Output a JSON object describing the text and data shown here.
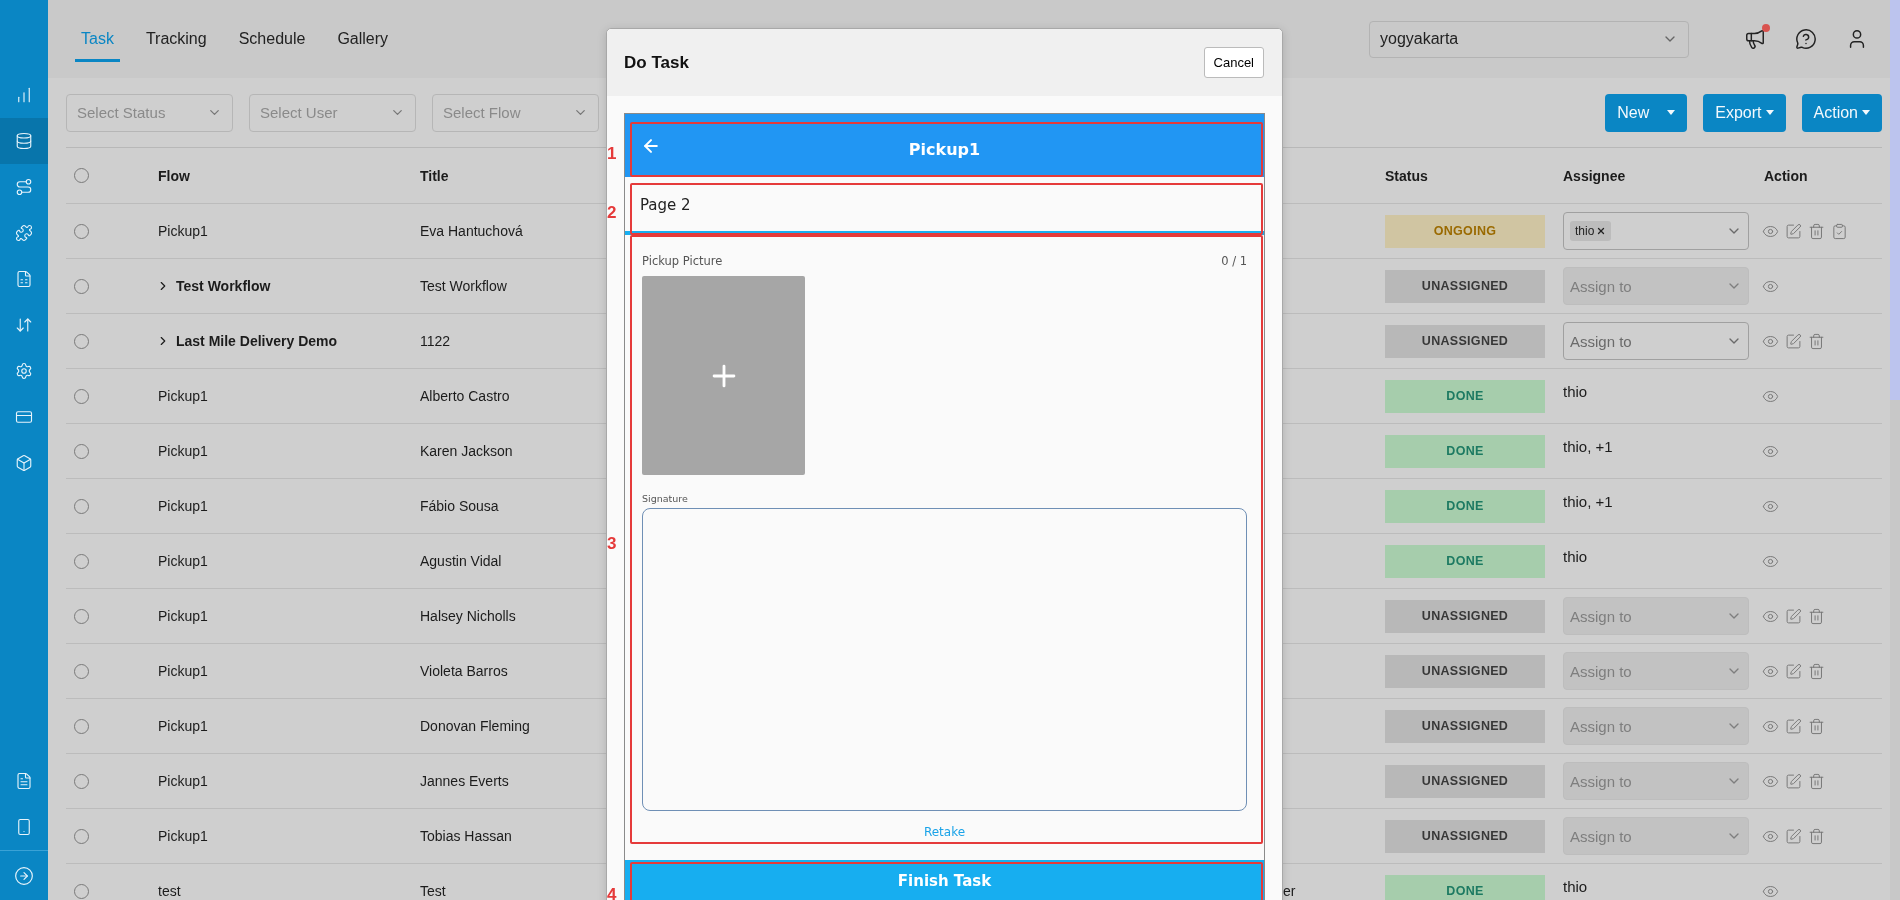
{
  "sidebar": {
    "items": [
      {
        "kind": "chart",
        "selected": false
      },
      {
        "kind": "database",
        "selected": true
      },
      {
        "kind": "route",
        "selected": false
      },
      {
        "kind": "puzzle",
        "selected": false
      },
      {
        "kind": "sheet",
        "selected": false
      },
      {
        "kind": "swap",
        "selected": false
      },
      {
        "kind": "settings",
        "selected": false
      },
      {
        "kind": "card",
        "selected": false
      },
      {
        "kind": "box",
        "selected": false
      }
    ],
    "bottom_items": [
      {
        "kind": "document",
        "selected": false
      },
      {
        "kind": "phone",
        "selected": false
      }
    ]
  },
  "tabs": [
    {
      "label": "Task",
      "selected": true
    },
    {
      "label": "Tracking",
      "selected": false
    },
    {
      "label": "Schedule",
      "selected": false
    },
    {
      "label": "Gallery",
      "selected": false
    }
  ],
  "region_select": {
    "value": "yogyakarta"
  },
  "header_icons": [
    {
      "kind": "announcement",
      "badge": true
    },
    {
      "kind": "help",
      "badge": false
    },
    {
      "kind": "account",
      "badge": false
    }
  ],
  "filters": [
    {
      "placeholder": "Select Status"
    },
    {
      "placeholder": "Select User"
    },
    {
      "placeholder": "Select Flow"
    }
  ],
  "buttons": [
    {
      "label": "New",
      "split": true
    },
    {
      "label": "Export",
      "split": false
    },
    {
      "label": "Action",
      "split": false
    }
  ],
  "table": {
    "columns": [
      "Flow",
      "Title",
      "Status",
      "Assignee",
      "Action"
    ],
    "header_checked": false,
    "rows": [
      {
        "checked": false,
        "kind": "task",
        "flow": "Pickup1",
        "title": "Eva Hantuchová",
        "status": {
          "label": "ONGOING",
          "kind": "ongoing"
        },
        "assignee": {
          "kind": "tag",
          "value": "thio"
        },
        "actions": [
          {
            "kind": "view"
          },
          {
            "kind": "edit"
          },
          {
            "kind": "delete"
          },
          {
            "kind": "review"
          }
        ]
      },
      {
        "checked": false,
        "kind": "group",
        "expanded": false,
        "flow": "Test Workflow",
        "title": "Test Workflow",
        "status": {
          "label": "UNASSIGNED",
          "kind": "unassigned"
        },
        "assignee": {
          "kind": "select",
          "placeholder": "Assign to",
          "disabled": true
        },
        "actions": [
          {
            "kind": "view"
          }
        ]
      },
      {
        "checked": false,
        "kind": "group",
        "expanded": false,
        "flow": "Last Mile Delivery Demo",
        "title": "1122",
        "status": {
          "label": "UNASSIGNED",
          "kind": "unassigned"
        },
        "assignee": {
          "kind": "select",
          "placeholder": "Assign to",
          "disabled": false
        },
        "actions": [
          {
            "kind": "view"
          },
          {
            "kind": "edit"
          },
          {
            "kind": "delete"
          }
        ]
      },
      {
        "checked": false,
        "kind": "task",
        "flow": "Pickup1",
        "title": "Alberto Castro",
        "status": {
          "label": "DONE",
          "kind": "done"
        },
        "assignee": {
          "kind": "text",
          "value": "thio"
        },
        "actions": [
          {
            "kind": "view"
          }
        ]
      },
      {
        "checked": false,
        "kind": "task",
        "flow": "Pickup1",
        "title": "Karen Jackson",
        "status": {
          "label": "DONE",
          "kind": "done"
        },
        "assignee": {
          "kind": "text",
          "value": "thio, +1"
        },
        "actions": [
          {
            "kind": "view"
          }
        ]
      },
      {
        "checked": false,
        "kind": "task",
        "flow": "Pickup1",
        "title": "Fábio Sousa",
        "status": {
          "label": "DONE",
          "kind": "done"
        },
        "assignee": {
          "kind": "text",
          "value": "thio, +1"
        },
        "actions": [
          {
            "kind": "view"
          }
        ]
      },
      {
        "checked": false,
        "kind": "task",
        "flow": "Pickup1",
        "title": "Agustin Vidal",
        "status": {
          "label": "DONE",
          "kind": "done"
        },
        "assignee": {
          "kind": "text",
          "value": "thio"
        },
        "actions": [
          {
            "kind": "view"
          }
        ]
      },
      {
        "checked": false,
        "kind": "task",
        "flow": "Pickup1",
        "title": "Halsey Nicholls",
        "status": {
          "label": "UNASSIGNED",
          "kind": "unassigned"
        },
        "assignee": {
          "kind": "select",
          "placeholder": "Assign to",
          "disabled": true
        },
        "actions": [
          {
            "kind": "view"
          },
          {
            "kind": "edit"
          },
          {
            "kind": "delete"
          }
        ]
      },
      {
        "checked": false,
        "kind": "task",
        "flow": "Pickup1",
        "title": "Violeta Barros",
        "status": {
          "label": "UNASSIGNED",
          "kind": "unassigned"
        },
        "assignee": {
          "kind": "select",
          "placeholder": "Assign to",
          "disabled": true
        },
        "actions": [
          {
            "kind": "view"
          },
          {
            "kind": "edit"
          },
          {
            "kind": "delete"
          }
        ]
      },
      {
        "checked": false,
        "kind": "task",
        "flow": "Pickup1",
        "title": "Donovan Fleming",
        "status": {
          "label": "UNASSIGNED",
          "kind": "unassigned"
        },
        "assignee": {
          "kind": "select",
          "placeholder": "Assign to",
          "disabled": true
        },
        "actions": [
          {
            "kind": "view"
          },
          {
            "kind": "edit"
          },
          {
            "kind": "delete"
          }
        ]
      },
      {
        "checked": false,
        "kind": "task",
        "flow": "Pickup1",
        "title": "Jannes Everts",
        "status": {
          "label": "UNASSIGNED",
          "kind": "unassigned"
        },
        "assignee": {
          "kind": "select",
          "placeholder": "Assign to",
          "disabled": true
        },
        "actions": [
          {
            "kind": "view"
          },
          {
            "kind": "edit"
          },
          {
            "kind": "delete"
          }
        ]
      },
      {
        "checked": false,
        "kind": "task",
        "flow": "Pickup1",
        "title": "Tobias Hassan",
        "status": {
          "label": "UNASSIGNED",
          "kind": "unassigned"
        },
        "assignee": {
          "kind": "select",
          "placeholder": "Assign to",
          "disabled": true
        },
        "actions": [
          {
            "kind": "view"
          },
          {
            "kind": "edit"
          },
          {
            "kind": "delete"
          }
        ]
      },
      {
        "checked": false,
        "kind": "task",
        "flow": "test",
        "title": "Test",
        "column_3": "er",
        "status": {
          "label": "DONE",
          "kind": "done"
        },
        "assignee": {
          "kind": "text",
          "value": "thio"
        },
        "actions": [
          {
            "kind": "view"
          }
        ]
      }
    ]
  },
  "modal": {
    "title": "Do Task",
    "cancel": "Cancel",
    "app_bar": {
      "title": "Pickup1",
      "annotation": "1"
    },
    "page": {
      "title": "Page 2",
      "annotation": "2"
    },
    "form": {
      "annotation": "3",
      "picture": {
        "label": "Pickup Picture",
        "count": "0 / 1"
      },
      "signature": {
        "label": "Signature"
      },
      "retake": "Retake"
    },
    "finish": {
      "label": "Finish Task",
      "annotation": "4"
    }
  }
}
